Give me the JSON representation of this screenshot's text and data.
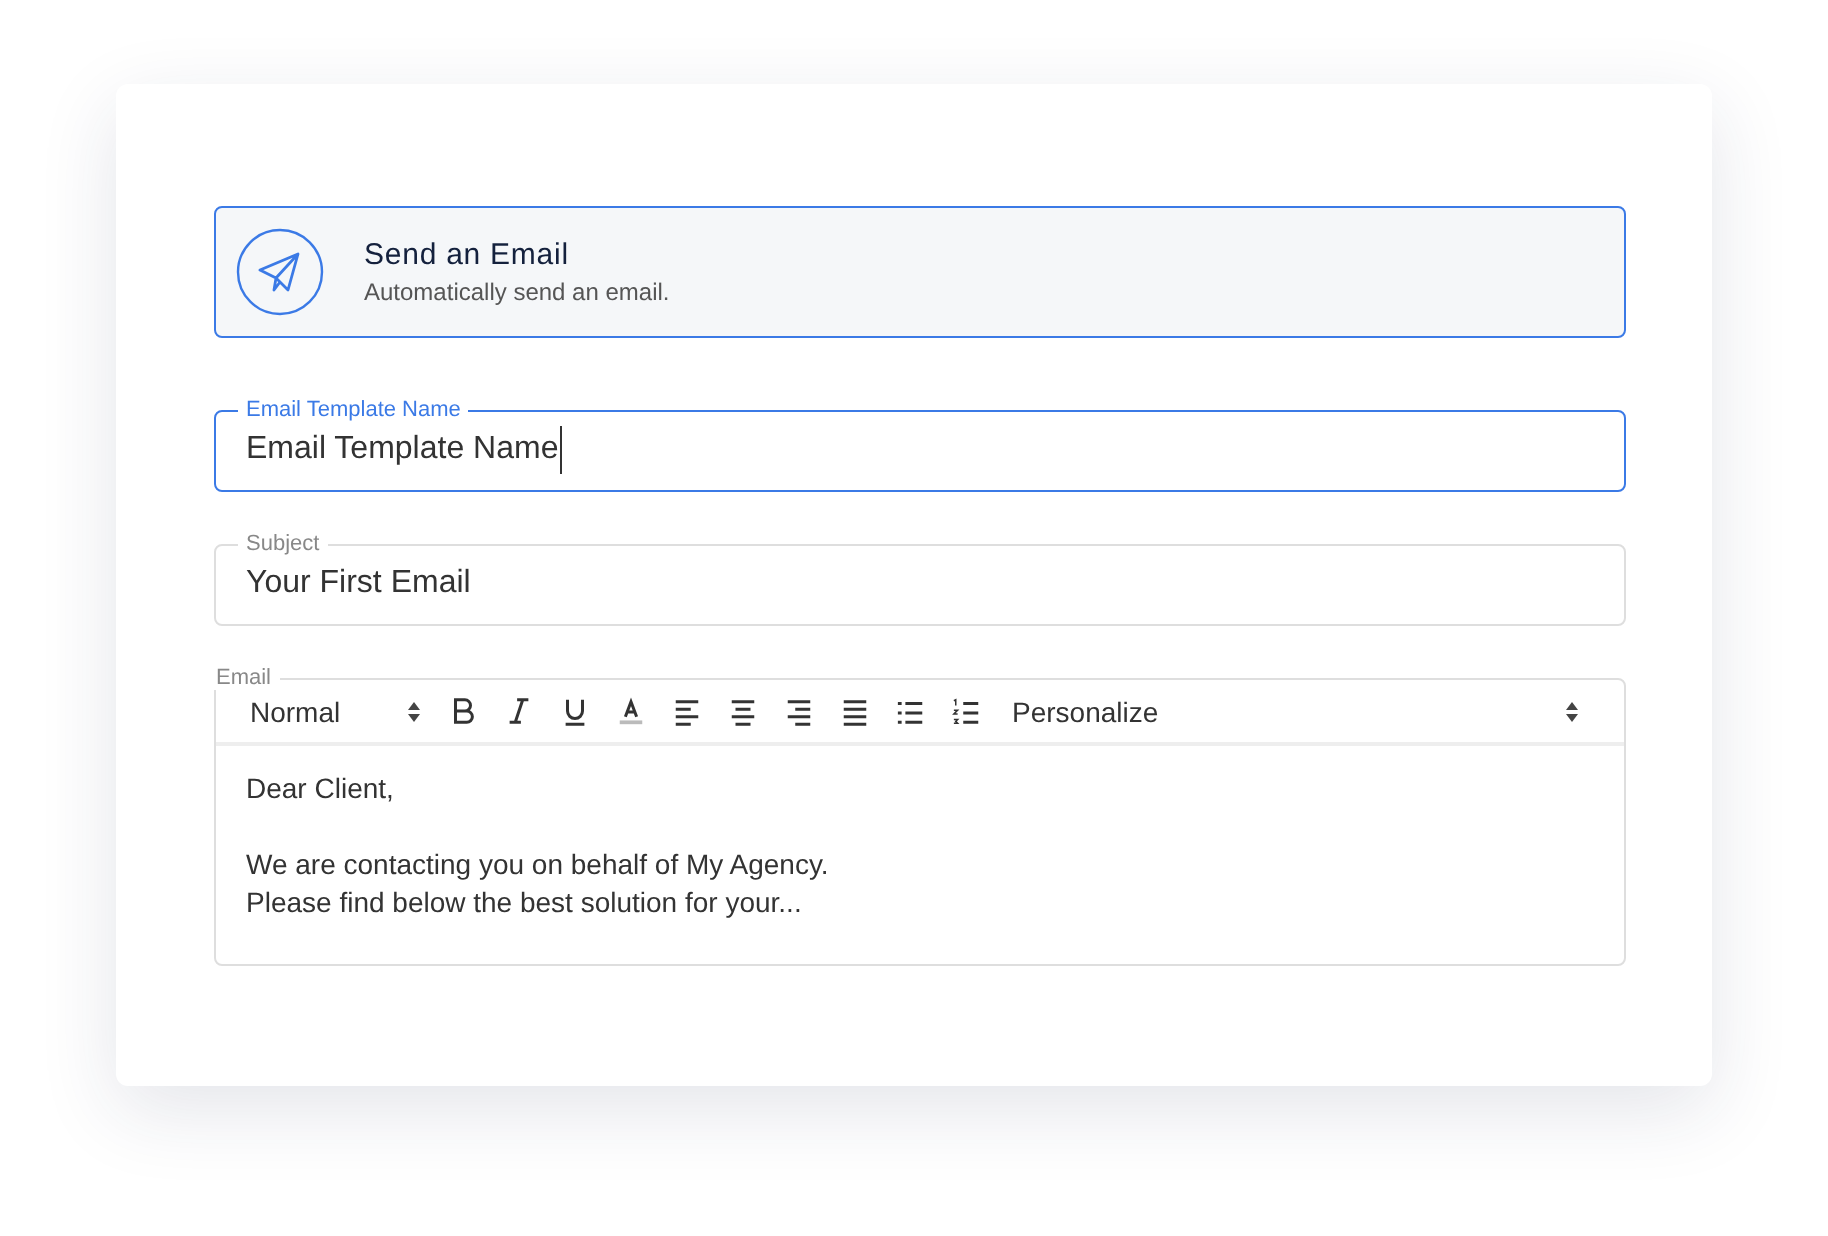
{
  "action": {
    "title": "Send an Email",
    "subtitle": "Automatically send an email."
  },
  "fields": [
    {
      "kind": "text",
      "label": "Email Template Name",
      "value": "Email Template Name",
      "focused": true
    },
    {
      "kind": "text",
      "label": "Subject",
      "value": "Your First Email",
      "focused": false
    },
    {
      "kind": "editor",
      "label": "Email",
      "focused": false,
      "format": "Normal",
      "tools": [
        {
          "kind": "bold"
        },
        {
          "kind": "italic"
        },
        {
          "kind": "underline"
        },
        {
          "kind": "color"
        },
        {
          "kind": "align-left"
        },
        {
          "kind": "align-center"
        },
        {
          "kind": "align-right"
        },
        {
          "kind": "justify"
        },
        {
          "kind": "bullet-list"
        },
        {
          "kind": "numbered-list"
        }
      ],
      "personalize": "Personalize",
      "paragraphs": [
        [
          "Dear Client,"
        ],
        [
          "We are contacting you on behalf of My Agency.",
          "Please find below the best solution for your..."
        ]
      ]
    }
  ]
}
